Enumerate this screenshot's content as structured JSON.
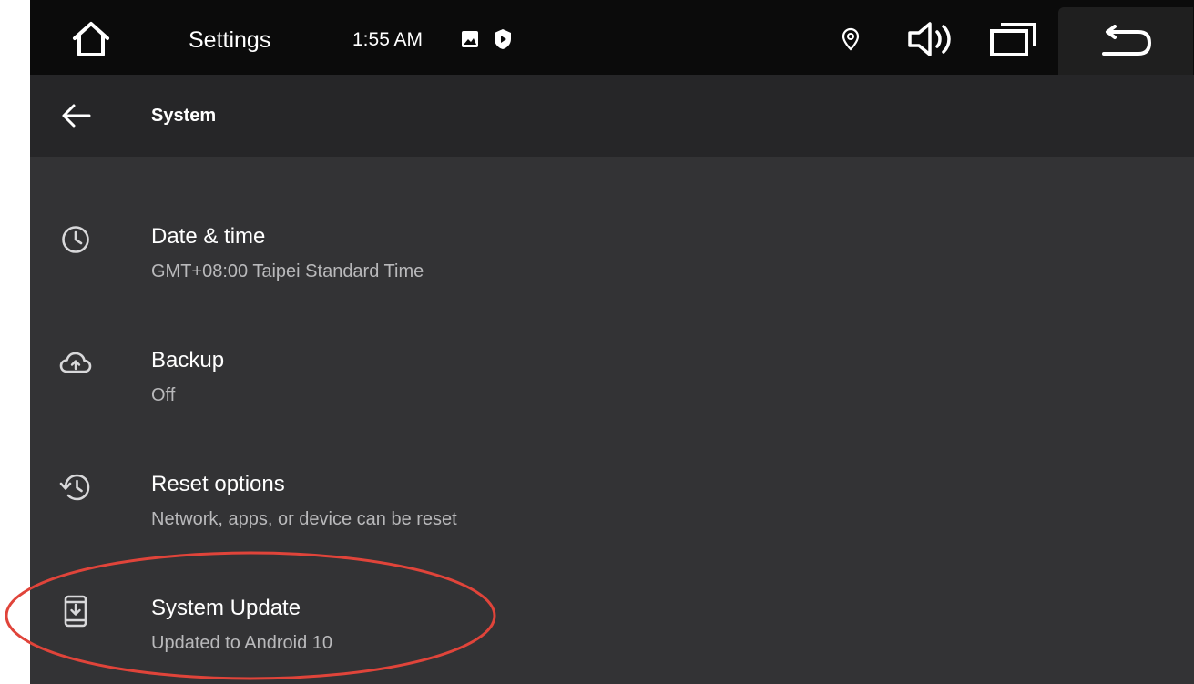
{
  "status_bar": {
    "app_title": "Settings",
    "time": "1:55 AM",
    "icons": [
      "home-icon",
      "image-notification-icon",
      "shield-notification-icon",
      "location-icon",
      "volume-icon",
      "recents-icon",
      "back-icon"
    ]
  },
  "toolbar": {
    "title": "System",
    "back_icon": "arrow-left-icon"
  },
  "items": [
    {
      "title": "Date & time",
      "summary": "GMT+08:00 Taipei Standard Time",
      "icon": "clock-icon"
    },
    {
      "title": "Backup",
      "summary": "Off",
      "icon": "cloud-upload-icon"
    },
    {
      "title": "Reset options",
      "summary": "Network, apps, or device can be reset",
      "icon": "history-icon"
    },
    {
      "title": "System Update",
      "summary": "Updated to Android 10",
      "icon": "system-update-icon"
    }
  ],
  "colors": {
    "status_bar_bg": "#0b0b0b",
    "toolbar_bg": "#262628",
    "content_bg": "#333335",
    "highlight": "#e0443a"
  }
}
